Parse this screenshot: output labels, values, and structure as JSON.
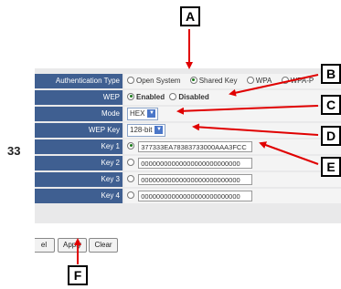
{
  "page_number": "33",
  "form": {
    "auth_type": {
      "label": "Authentication Type",
      "options": [
        "Open System",
        "Shared Key",
        "WPA",
        "WPA-P"
      ],
      "selected": "Shared Key"
    },
    "wep": {
      "label": "WEP",
      "options": [
        "Enabled",
        "Disabled"
      ],
      "selected": "Enabled"
    },
    "mode": {
      "label": "Mode",
      "value": "HEX"
    },
    "wep_key": {
      "label": "WEP Key",
      "value": "128-bit"
    },
    "keys": [
      {
        "label": "Key 1",
        "value": "377333EA78383733000AAA3FCC",
        "selected": true
      },
      {
        "label": "Key 2",
        "value": "00000000000000000000000000",
        "selected": false
      },
      {
        "label": "Key 3",
        "value": "00000000000000000000000000",
        "selected": false
      },
      {
        "label": "Key 4",
        "value": "00000000000000000000000000",
        "selected": false
      }
    ]
  },
  "buttons": {
    "cancel": "el",
    "apply": "Apply",
    "clear": "Clear"
  },
  "callouts": {
    "a": "A",
    "b": "B",
    "c": "C",
    "d": "D",
    "e": "E",
    "f": "F"
  },
  "colors": {
    "label_bg": "#3f5f91",
    "form_bg": "#e9e9ea",
    "arrow": "#e00000"
  }
}
